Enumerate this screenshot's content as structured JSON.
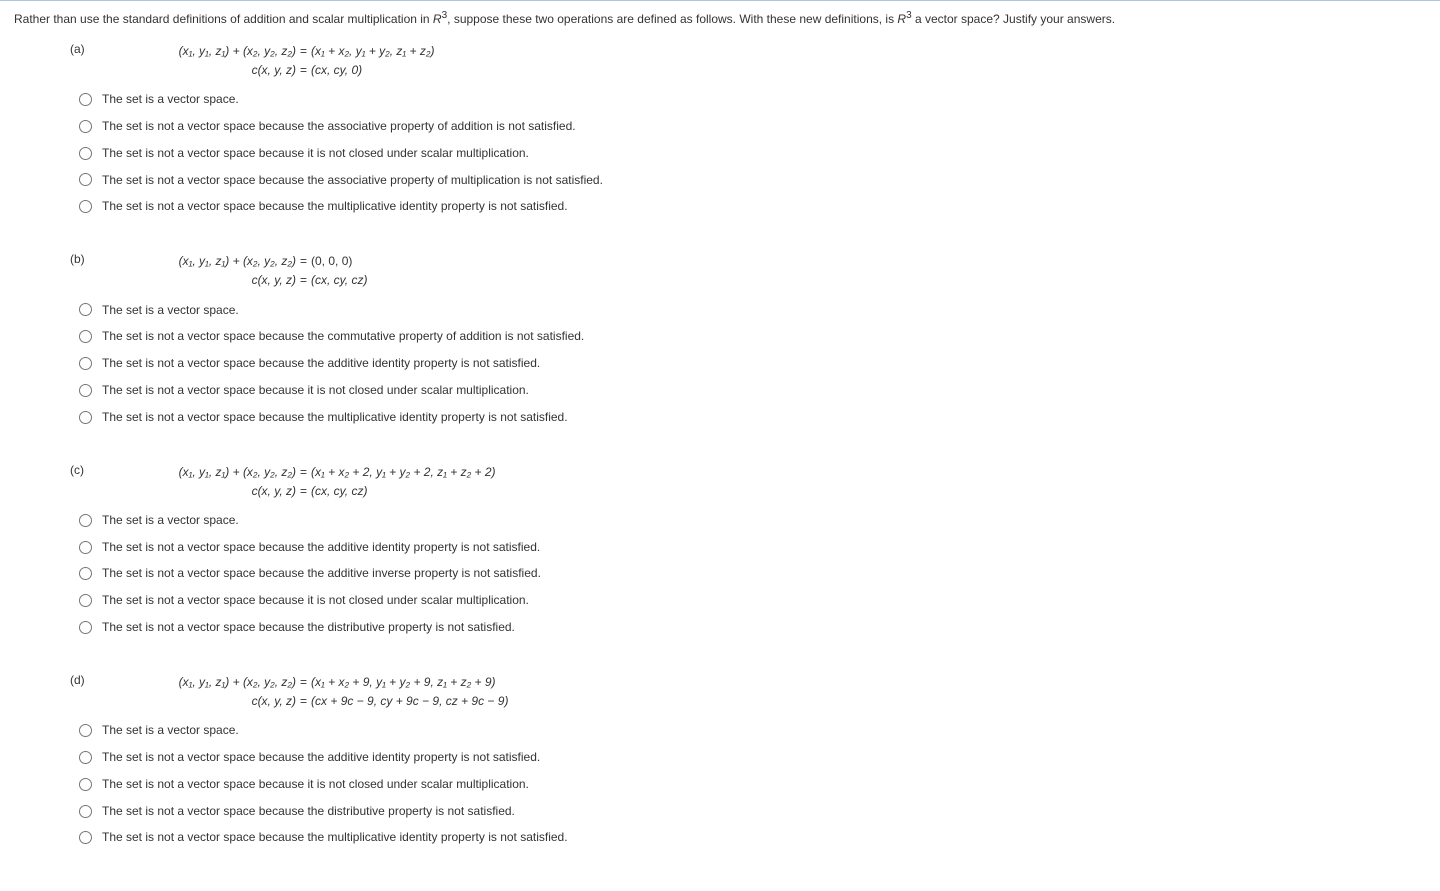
{
  "intro_pre": "Rather than use the standard definitions of addition and scalar multiplication in ",
  "intro_R": "R",
  "intro_sup": "3",
  "intro_mid": ", suppose these two operations are defined as follows. With these new definitions, is ",
  "intro_R2": "R",
  "intro_sup2": "3",
  "intro_end": " a vector space? Justify your answers.",
  "parts": {
    "a": {
      "label": "(a)",
      "eq_add_lhs": "(x₁, y₁, z₁) + (x₂, y₂, z₂)",
      "eq_add_rhs": "(x₁ + x₂, y₁ + y₂, z₁ + z₂)",
      "eq_scl_lhs": "c(x, y, z)",
      "eq_scl_rhs": "(cx, cy, 0)",
      "options": [
        "The set is a vector space.",
        "The set is not a vector space because the associative property of addition is not satisfied.",
        "The set is not a vector space because it is not closed under scalar multiplication.",
        "The set is not a vector space because the associative property of multiplication is not satisfied.",
        "The set is not a vector space because the multiplicative identity property is not satisfied."
      ]
    },
    "b": {
      "label": "(b)",
      "eq_add_lhs": "(x₁, y₁, z₁) + (x₂, y₂, z₂)",
      "eq_add_rhs": "(0, 0, 0)",
      "eq_scl_lhs": "c(x, y, z)",
      "eq_scl_rhs": "(cx, cy, cz)",
      "options": [
        "The set is a vector space.",
        "The set is not a vector space because the commutative property of addition is not satisfied.",
        "The set is not a vector space because the additive identity property is not satisfied.",
        "The set is not a vector space because it is not closed under scalar multiplication.",
        "The set is not a vector space because the multiplicative identity property is not satisfied."
      ]
    },
    "c": {
      "label": "(c)",
      "eq_add_lhs": "(x₁, y₁, z₁) + (x₂, y₂, z₂)",
      "eq_add_rhs": "(x₁ + x₂ + 2, y₁ + y₂ + 2, z₁ + z₂ + 2)",
      "eq_scl_lhs": "c(x, y, z)",
      "eq_scl_rhs": "(cx, cy, cz)",
      "options": [
        "The set is a vector space.",
        "The set is not a vector space because the additive identity property is not satisfied.",
        "The set is not a vector space because the additive inverse property is not satisfied.",
        "The set is not a vector space because it is not closed under scalar multiplication.",
        "The set is not a vector space because the distributive property is not satisfied."
      ]
    },
    "d": {
      "label": "(d)",
      "eq_add_lhs": "(x₁, y₁, z₁) + (x₂, y₂, z₂)",
      "eq_add_rhs": "(x₁ + x₂ + 9, y₁ + y₂ + 9, z₁ + z₂ + 9)",
      "eq_scl_lhs": "c(x, y, z)",
      "eq_scl_rhs": "(cx + 9c − 9, cy + 9c − 9, cz + 9c − 9)",
      "options": [
        "The set is a vector space.",
        "The set is not a vector space because the additive identity property is not satisfied.",
        "The set is not a vector space because it is not closed under scalar multiplication.",
        "The set is not a vector space because the distributive property is not satisfied.",
        "The set is not a vector space because the multiplicative identity property is not satisfied."
      ]
    }
  }
}
